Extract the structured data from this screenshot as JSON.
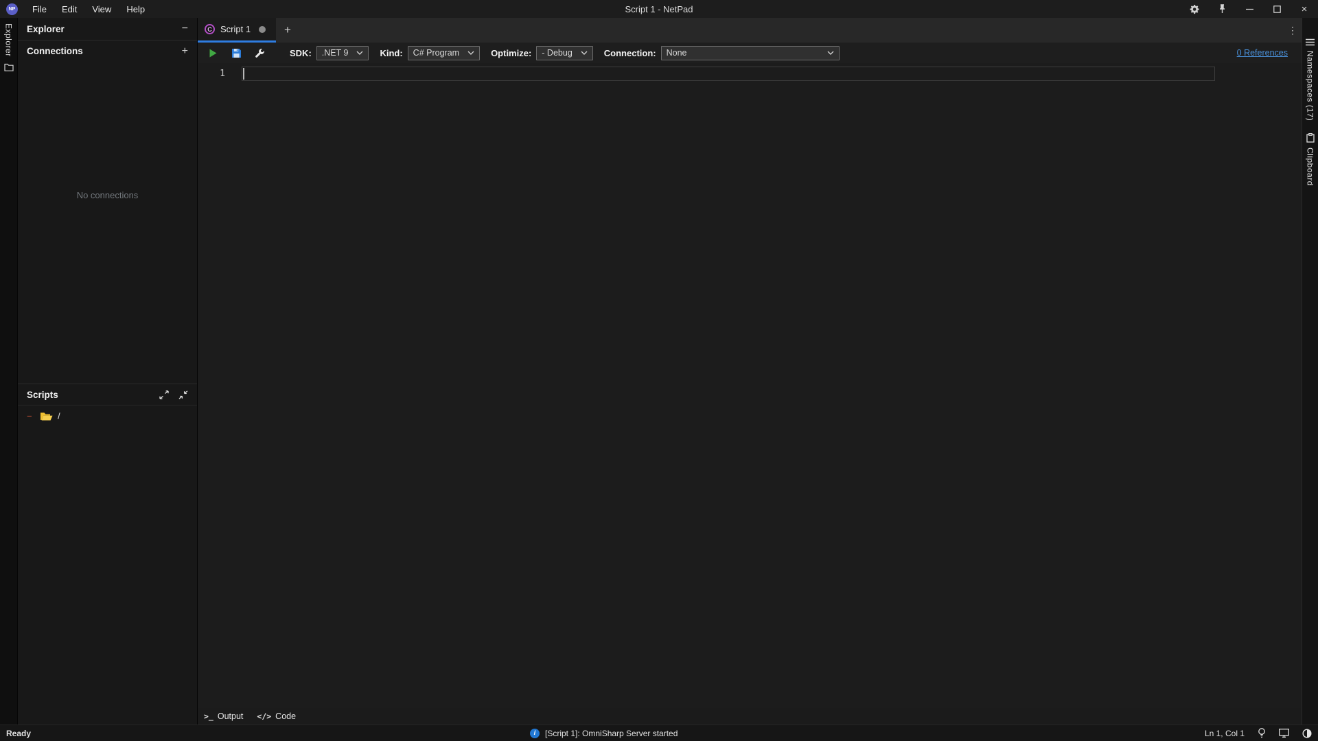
{
  "titlebar": {
    "logo": "NP",
    "menus": [
      "File",
      "Edit",
      "View",
      "Help"
    ],
    "title": "Script 1 - NetPad"
  },
  "explorer": {
    "header": "Explorer",
    "rail_label": "Explorer",
    "connections": {
      "header": "Connections",
      "empty_text": "No connections"
    },
    "scripts": {
      "header": "Scripts",
      "root_label": "/"
    }
  },
  "tabs": {
    "active_label": "Script 1",
    "icon_letter": "C"
  },
  "toolbar": {
    "sdk_label": "SDK:",
    "sdk_value": ".NET 9",
    "kind_label": "Kind:",
    "kind_value": "C# Program",
    "optimize_label": "Optimize:",
    "optimize_value": "- Debug",
    "connection_label": "Connection:",
    "connection_value": "None",
    "references_link": "0 References"
  },
  "editor": {
    "line_number": "1"
  },
  "bottom_bar": {
    "output_label": "Output",
    "code_label": "Code"
  },
  "right_rail": {
    "namespaces_label": "Namespaces (17)",
    "clipboard_label": "Clipboard"
  },
  "statusbar": {
    "ready": "Ready",
    "message": "[Script 1]: OmniSharp Server started",
    "cursor_position": "Ln 1, Col 1",
    "info_glyph": "i"
  },
  "icons": {
    "plus": "+",
    "section_minus": "−",
    "kebab": "⋮",
    "close": "×",
    "minimize": "—",
    "terminal": ">_",
    "code": "</>",
    "tree_collapse": "−"
  },
  "colors": {
    "accent": "#2f7de1",
    "link": "#4a90d9",
    "play_green": "#41a843",
    "save_blue": "#2b7cd9",
    "folder_yellow": "#f0c030",
    "collapse_orange": "#e25a3a",
    "info_blue": "#2178d4",
    "logo_purple": "#5b5fc7",
    "csharp_purple": "#b44fc8"
  }
}
